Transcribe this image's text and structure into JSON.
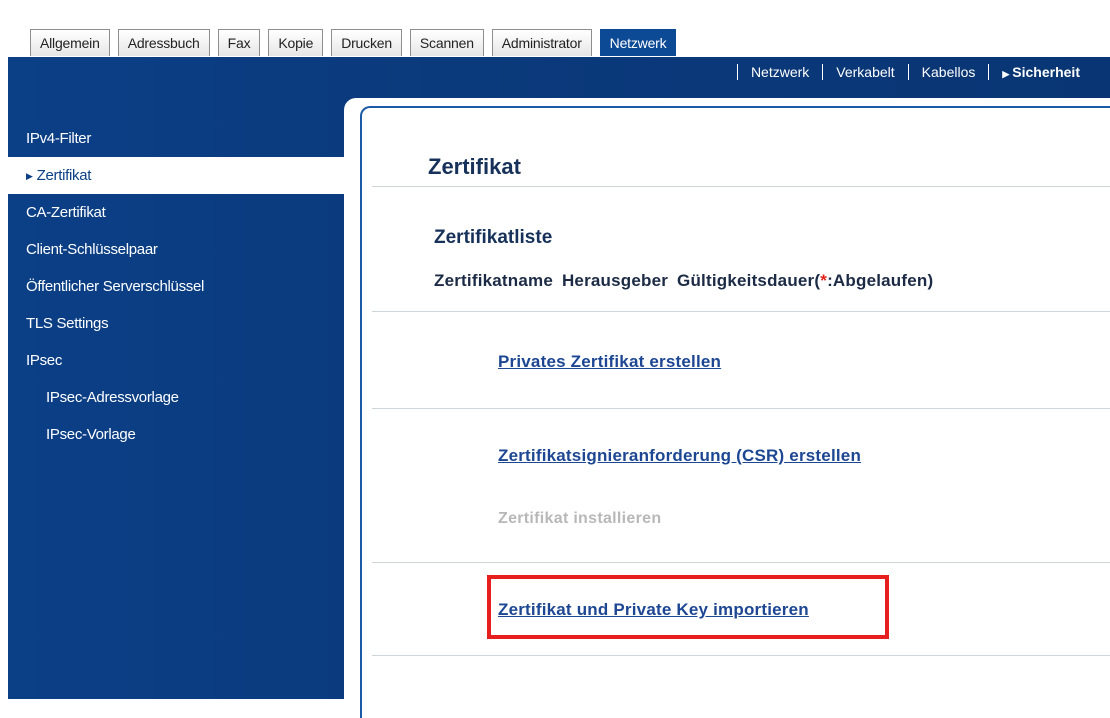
{
  "tabs": [
    {
      "label": "Allgemein"
    },
    {
      "label": "Adressbuch"
    },
    {
      "label": "Fax"
    },
    {
      "label": "Kopie"
    },
    {
      "label": "Drucken"
    },
    {
      "label": "Scannen"
    },
    {
      "label": "Administrator"
    },
    {
      "label": "Netzwerk"
    }
  ],
  "active_tab": "Netzwerk",
  "subnav": {
    "items": [
      "Netzwerk",
      "Verkabelt",
      "Kabellos",
      "Sicherheit"
    ],
    "active": "Sicherheit"
  },
  "sidebar": {
    "items": [
      {
        "label": "IPv4-Filter"
      },
      {
        "label": "Zertifikat"
      },
      {
        "label": "CA-Zertifikat"
      },
      {
        "label": "Client-Schlüsselpaar"
      },
      {
        "label": "Öffentlicher Serverschlüssel"
      },
      {
        "label": "TLS Settings"
      },
      {
        "label": "IPsec"
      },
      {
        "label": "IPsec-Adressvorlage"
      },
      {
        "label": "IPsec-Vorlage"
      }
    ]
  },
  "main": {
    "title": "Zertifikat",
    "list_heading": "Zertifikatliste",
    "columns": {
      "name": "Zertifikatname",
      "issuer": "Herausgeber",
      "validity_prefix": "Gültigkeitsdauer(",
      "star": "*",
      "validity_suffix": ":Abgelaufen)"
    },
    "actions": {
      "create_private": "Privates Zertifikat erstellen",
      "create_csr": "Zertifikatsignieranforderung (CSR) erstellen",
      "install": "Zertifikat installieren",
      "import": "Zertifikat und Private Key importieren"
    }
  },
  "colors": {
    "brand_blue": "#0b3f86",
    "link": "#1d4793",
    "highlight": "#e61e1e"
  }
}
